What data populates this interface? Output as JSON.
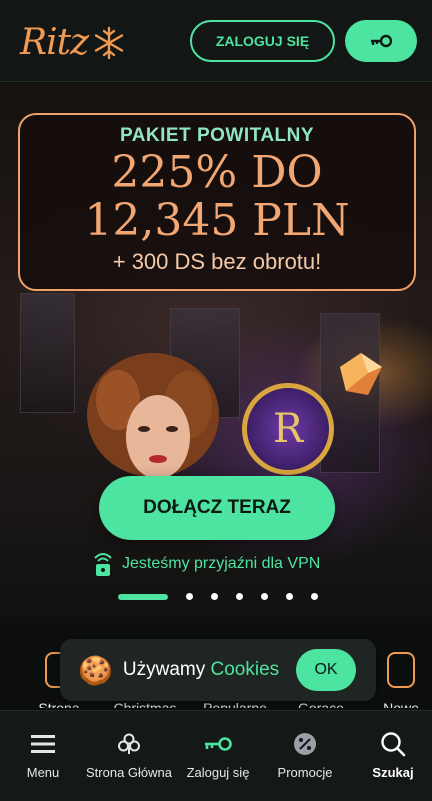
{
  "header": {
    "logo_text": "Ritz",
    "login_label": "ZALOGUJ SIĘ",
    "key_icon": "key-icon"
  },
  "hero": {
    "promo_kicker": "PAKIET POWITALNY",
    "promo_line1": "225% DO",
    "promo_line2": "12,345 PLN",
    "promo_sub": "+ 300 DS bez obrotu!",
    "emblem_letter": "R",
    "join_label": "DOŁĄCZ TERAZ",
    "vpn_text": "Jesteśmy przyjaźni dla VPN",
    "slides_total": 7,
    "slide_active": 1
  },
  "categories": [
    {
      "label": "Strona"
    },
    {
      "label": "Christmas"
    },
    {
      "label": "Popularne"
    },
    {
      "label": "Gorące"
    },
    {
      "label": "Nowe"
    }
  ],
  "cookie": {
    "text": "Używamy ",
    "link": "Cookies",
    "ok_label": "OK"
  },
  "nav": {
    "items": [
      {
        "label": "Menu",
        "icon": "menu-icon"
      },
      {
        "label": "Strona Główna",
        "icon": "club-icon"
      },
      {
        "label": "Zaloguj się",
        "icon": "key-icon"
      },
      {
        "label": "Promocje",
        "icon": "percent-icon"
      },
      {
        "label": "Szukaj",
        "icon": "search-icon"
      }
    ]
  },
  "colors": {
    "accent": "#4de3a0",
    "brand": "#f09a52",
    "background": "#0d0f0e"
  }
}
